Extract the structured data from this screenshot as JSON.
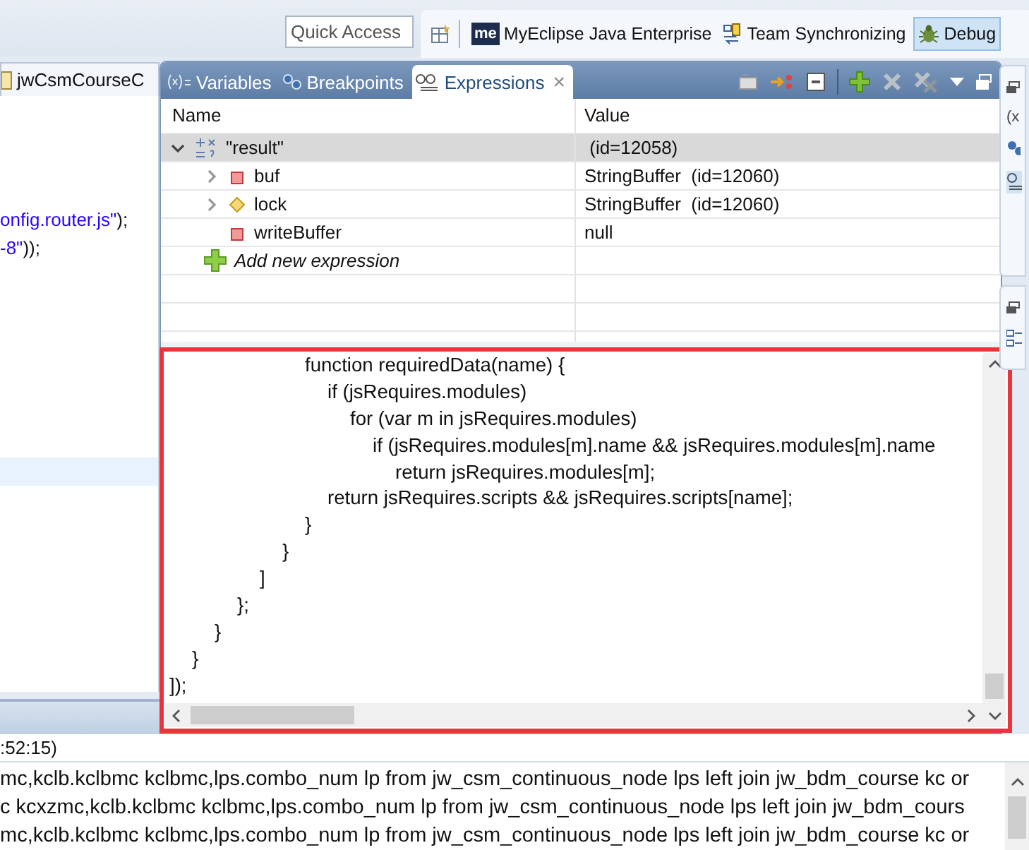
{
  "toolbar": {
    "quick_access": {
      "placeholder": "Quick Access"
    },
    "perspectives": [
      {
        "kind": "me",
        "badge": "me",
        "label": "MyEclipse Java Enterprise",
        "selected": false
      },
      {
        "kind": "team",
        "label": "Team Synchronizing",
        "selected": false
      },
      {
        "kind": "debug",
        "label": "Debug",
        "selected": true
      }
    ]
  },
  "editor": {
    "tab": "jwCsmCourseC",
    "lines": [
      {
        "parts": [
          {
            "kind": "string",
            "text": "onfig.router.js\""
          },
          {
            "kind": "plain",
            "text": ");"
          }
        ]
      },
      {
        "parts": [
          {
            "kind": "string",
            "text": "-8\""
          },
          {
            "kind": "plain",
            "text": "));"
          }
        ]
      }
    ]
  },
  "expressions_view": {
    "tabs": [
      {
        "kind": "variables",
        "label": "Variables",
        "selected": false
      },
      {
        "kind": "breakpoints",
        "label": "Breakpoints",
        "selected": false
      },
      {
        "kind": "expressions",
        "label": "Expressions",
        "selected": true,
        "close": "×"
      }
    ],
    "columns": [
      "Name",
      "Value"
    ],
    "rows": [
      {
        "kind": "expression",
        "name": "\"result\"",
        "value": " (id=12058)",
        "selected": true,
        "expanded": true,
        "children": [
          {
            "kind": "private",
            "name": "buf",
            "value": "StringBuffer  (id=12060)",
            "selected": false,
            "expanded": false
          },
          {
            "kind": "protected",
            "name": "lock",
            "value": "StringBuffer  (id=12060)",
            "selected": false,
            "expanded": false
          },
          {
            "kind": "private",
            "name": "writeBuffer",
            "value": "null",
            "selected": false
          }
        ]
      }
    ],
    "add_label": "Add new expression",
    "detail": {
      "lines": [
        "\t\t\t\t\t\tfunction requiredData(name) {",
        "\t\t\t\t\t\t\tif (jsRequires.modules)",
        "\t\t\t\t\t\t\t\tfor (var m in jsRequires.modules)",
        "\t\t\t\t\t\t\t\t\tif (jsRequires.modules[m].name && jsRequires.modules[m].name",
        "\t\t\t\t\t\t\t\t\t\treturn jsRequires.modules[m];",
        "\t\t\t\t\t\t\treturn jsRequires.scripts && jsRequires.scripts[name];",
        "\t\t\t\t\t\t}",
        "\t\t\t\t\t}",
        "\t\t\t\t]",
        "\t\t\t};",
        "\t\t}",
        "\t}",
        "]);"
      ]
    }
  },
  "side_trim": {
    "label": "(x"
  },
  "console": {
    "title": ":52:15)",
    "lines": [
      "mc,kclb.kclbmc kclbmc,lps.combo_num lp from jw_csm_continuous_node lps left join jw_bdm_course kc or",
      "c kcxzmc,kclb.kclbmc kclbmc,lps.combo_num lp from jw_csm_continuous_node lps left join jw_bdm_cours",
      "mc,kclb.kclbmc kclbmc,lps.combo_num lp from jw_csm_continuous_node lps left join jw_bdm_course kc or"
    ]
  }
}
